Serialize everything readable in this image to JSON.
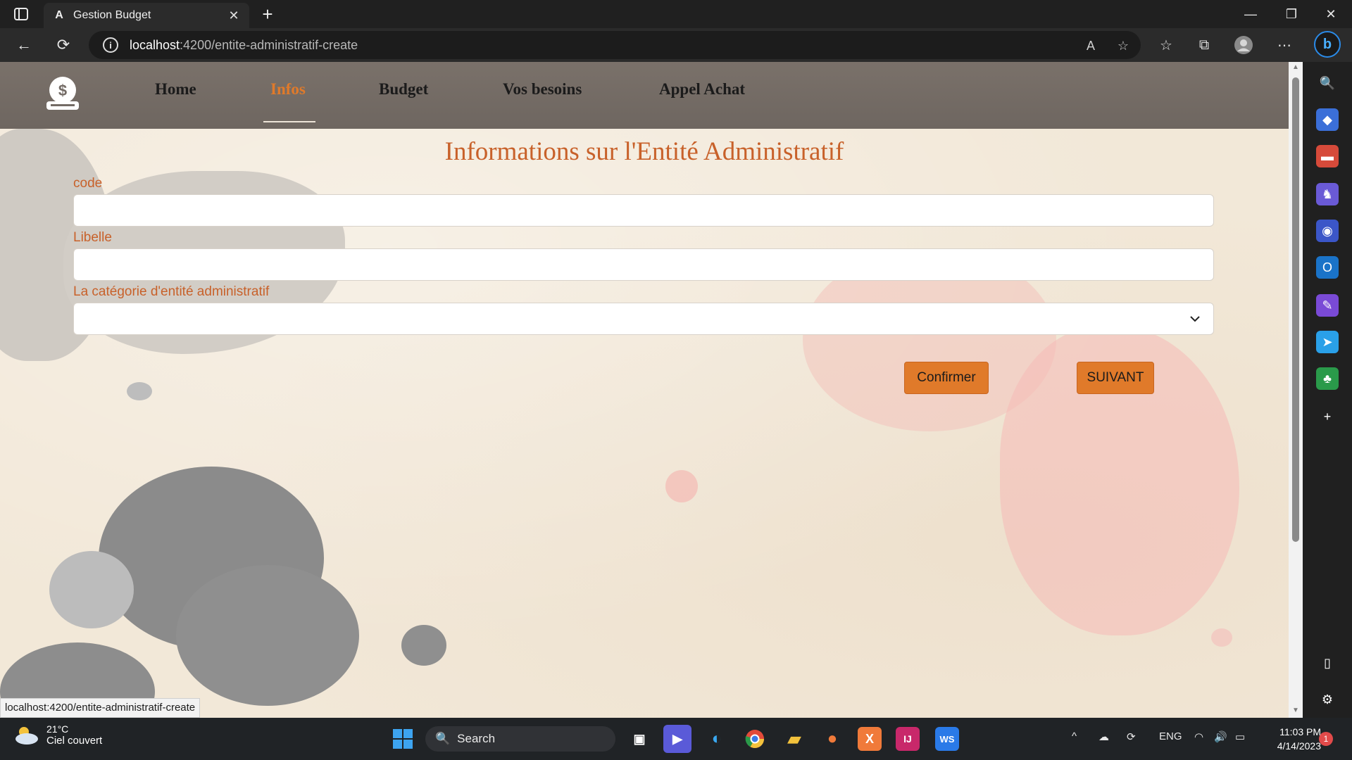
{
  "browser": {
    "tab_title": "Gestion Budget",
    "url_host": "localhost",
    "url_path": ":4200/entite-administratif-create",
    "status_link": "localhost:4200/entite-administratif-create"
  },
  "nav": {
    "items": [
      {
        "label": "Home"
      },
      {
        "label": "Infos",
        "active": true
      },
      {
        "label": "Budget"
      },
      {
        "label": "Vos besoins"
      },
      {
        "label": "Appel Achat"
      }
    ]
  },
  "page": {
    "title": "Informations sur l'Entité Administratif",
    "code_label": "code",
    "code_value": "",
    "libelle_label": "Libelle",
    "libelle_value": "",
    "categorie_label": "La catégorie d'entité administratif",
    "categorie_value": "",
    "confirm_label": "Confirmer",
    "next_label": "SUIVANT"
  },
  "taskbar": {
    "temperature": "21°C",
    "weather": "Ciel couvert",
    "search_label": "Search",
    "language": "ENG",
    "time": "11:03 PM",
    "date": "4/14/2023",
    "notifications": "1"
  },
  "colors": {
    "accent": "#e07a2a",
    "title": "#c8612a",
    "header": "#736b65"
  }
}
